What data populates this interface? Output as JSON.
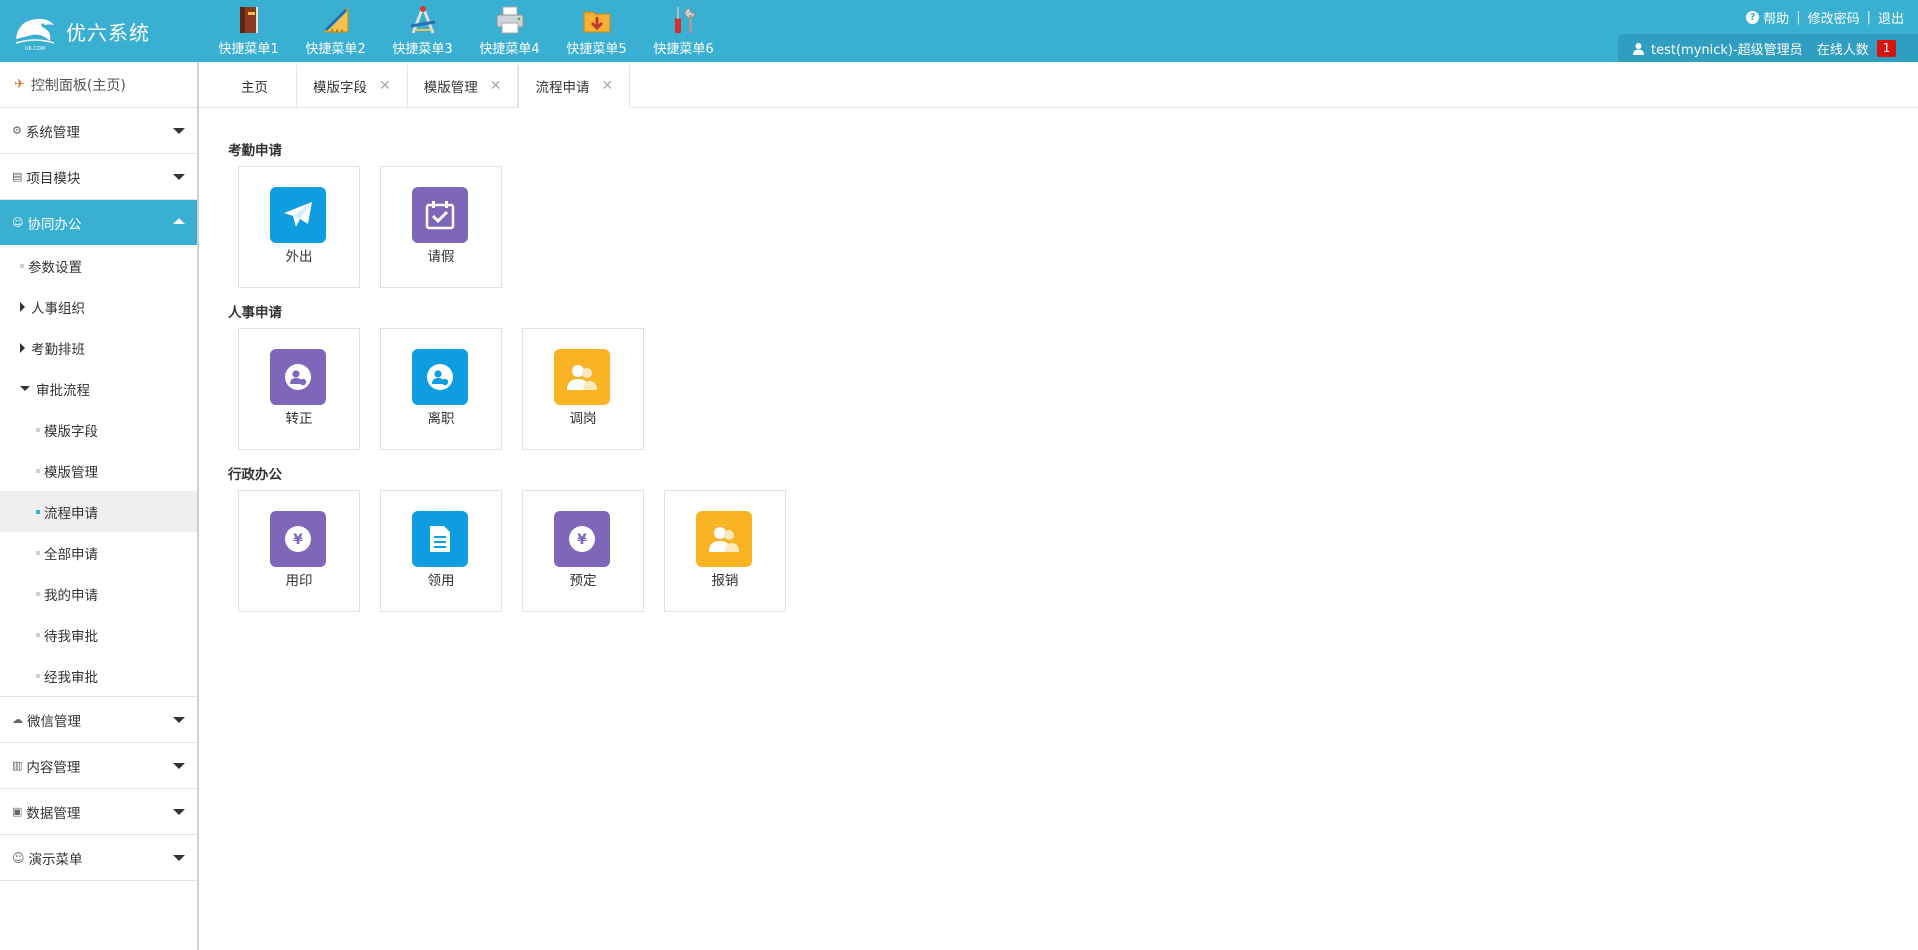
{
  "header": {
    "app_title": "优六系统",
    "quick_menu": [
      {
        "label": "快捷菜单1",
        "icon": "book-icon"
      },
      {
        "label": "快捷菜单2",
        "icon": "ruler-icon"
      },
      {
        "label": "快捷菜单3",
        "icon": "compass-icon"
      },
      {
        "label": "快捷菜单4",
        "icon": "printer-icon"
      },
      {
        "label": "快捷菜单5",
        "icon": "download-folder-icon"
      },
      {
        "label": "快捷菜单6",
        "icon": "tools-icon"
      }
    ],
    "links": {
      "help": "帮助",
      "change_password": "修改密码",
      "logout": "退出"
    },
    "user": "test(mynick)-超级管理员",
    "online_label": "在线人数",
    "online_count": "1"
  },
  "sidebar": {
    "home": "控制面板(主页)",
    "groups": [
      {
        "label": "系统管理"
      },
      {
        "label": "项目模块"
      },
      {
        "label": "协同办公"
      },
      {
        "label": "微信管理"
      },
      {
        "label": "内容管理"
      },
      {
        "label": "数据管理"
      },
      {
        "label": "演示菜单"
      }
    ],
    "cowork_items": {
      "params": "参数设置",
      "hr_org": "人事组织",
      "attendance": "考勤排班",
      "approval": "审批流程",
      "approval_children": [
        "模版字段",
        "模版管理",
        "流程申请",
        "全部申请",
        "我的申请",
        "待我审批",
        "经我审批"
      ]
    }
  },
  "tabs": [
    {
      "label": "主页"
    },
    {
      "label": "模版字段"
    },
    {
      "label": "模版管理"
    },
    {
      "label": "流程申请"
    }
  ],
  "sections": [
    {
      "title": "考勤申请",
      "items": [
        {
          "label": "外出"
        },
        {
          "label": "请假"
        }
      ]
    },
    {
      "title": "人事申请",
      "items": [
        {
          "label": "转正"
        },
        {
          "label": "离职"
        },
        {
          "label": "调岗"
        }
      ]
    },
    {
      "title": "行政办公",
      "items": [
        {
          "label": "用印"
        },
        {
          "label": "领用"
        },
        {
          "label": "预定"
        },
        {
          "label": "报销"
        }
      ]
    }
  ],
  "colors": {
    "header": "#39b0d2",
    "blue": "#0e9ee0",
    "purple": "#7e66b8",
    "yellow": "#f9b425",
    "badge": "#d9140e"
  }
}
